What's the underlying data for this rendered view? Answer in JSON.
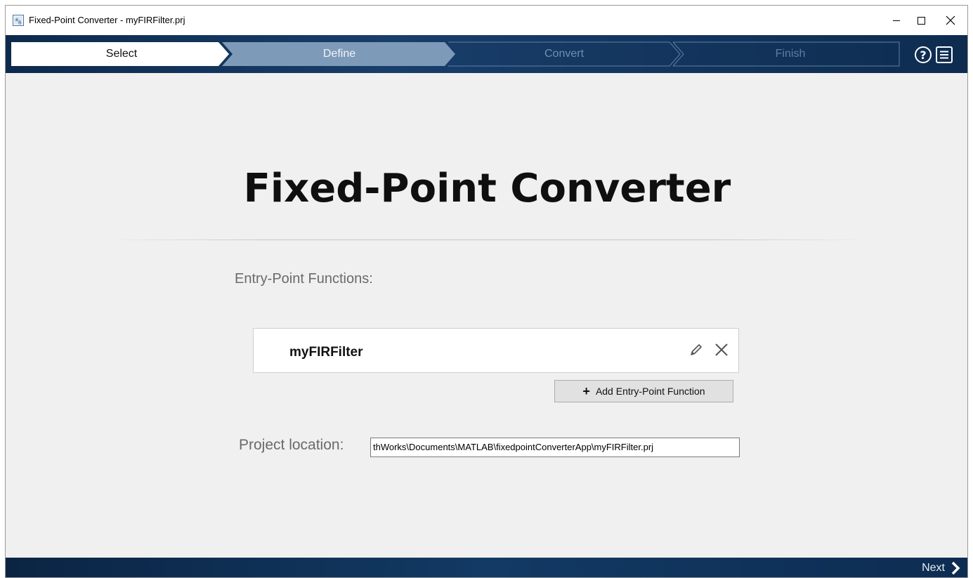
{
  "window": {
    "title": "Fixed-Point Converter - myFIRFilter.prj",
    "controls": {
      "minimize_icon": "minimize-icon",
      "maximize_icon": "maximize-icon",
      "close_icon": "close-icon"
    }
  },
  "wizard": {
    "steps": [
      {
        "label": "Select",
        "state": "active"
      },
      {
        "label": "Define",
        "state": "next"
      },
      {
        "label": "Convert",
        "state": "inactive"
      },
      {
        "label": "Finish",
        "state": "inactive"
      }
    ],
    "help_icon": "help-icon",
    "menu_icon": "menu-icon"
  },
  "main": {
    "title": "Fixed-Point Converter",
    "entry_points_label": "Entry-Point Functions:",
    "entry_points": [
      {
        "name": "myFIRFilter"
      }
    ],
    "add_button_label": "Add Entry-Point Function",
    "project_location_label": "Project location:",
    "project_location_value": "thWorks\\Documents\\MATLAB\\fixedpointConverterApp\\myFIRFilter.prj"
  },
  "footer": {
    "next_label": "Next"
  },
  "colors": {
    "wizard_bg": "#0d2a4c",
    "step_active": "#ffffff",
    "step_next": "#7e9ab9",
    "step_inactive_text": "#6f8eb1",
    "footer_bg": "#0b2444"
  }
}
